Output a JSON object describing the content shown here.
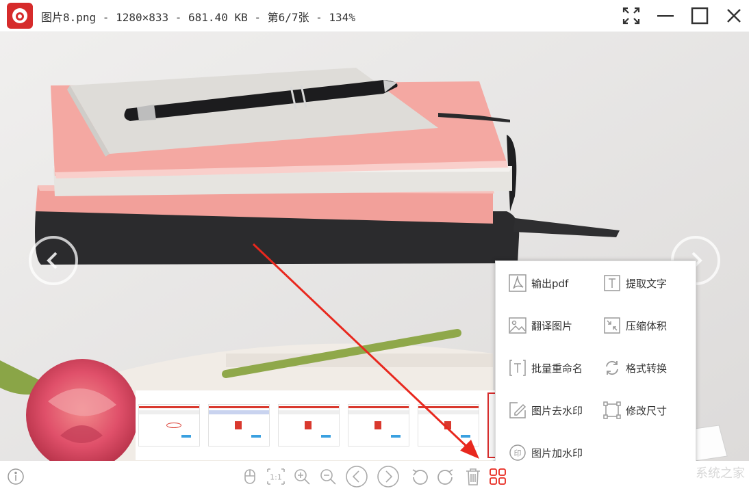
{
  "window": {
    "title": "图片8.png - 1280×833 - 681.40 KB - 第6/7张 - 134%"
  },
  "titlebar_buttons": [
    "fullscreen-icon",
    "minimize-icon",
    "maximize-icon",
    "close-icon"
  ],
  "thumbnails": [
    {
      "name": "thumb-1"
    },
    {
      "name": "thumb-2"
    },
    {
      "name": "thumb-3"
    },
    {
      "name": "thumb-4"
    },
    {
      "name": "thumb-5"
    },
    {
      "name": "thumb-6-current"
    }
  ],
  "menu": {
    "items": [
      {
        "label": "输出pdf",
        "icon": "pdf-icon"
      },
      {
        "label": "提取文字",
        "icon": "text-extract-icon"
      },
      {
        "label": "翻译图片",
        "icon": "image-translate-icon"
      },
      {
        "label": "压缩体积",
        "icon": "compress-icon"
      },
      {
        "label": "批量重命名",
        "icon": "batch-rename-icon"
      },
      {
        "label": "格式转换",
        "icon": "format-convert-icon"
      },
      {
        "label": "图片去水印",
        "icon": "remove-watermark-icon"
      },
      {
        "label": "修改尺寸",
        "icon": "resize-icon"
      },
      {
        "label": "图片加水印",
        "icon": "add-watermark-icon"
      }
    ]
  },
  "toolbar": {
    "one_to_one_label": "1:1",
    "tools": [
      "mouse-icon",
      "actual-size-icon",
      "zoom-in-icon",
      "zoom-out-icon",
      "prev-icon",
      "next-icon",
      "rotate-left-icon",
      "rotate-right-icon",
      "delete-icon",
      "more-tools-icon"
    ]
  },
  "watermark": "系统之家",
  "colors": {
    "accent": "#d62b2b",
    "arrow": "#e8281e"
  }
}
